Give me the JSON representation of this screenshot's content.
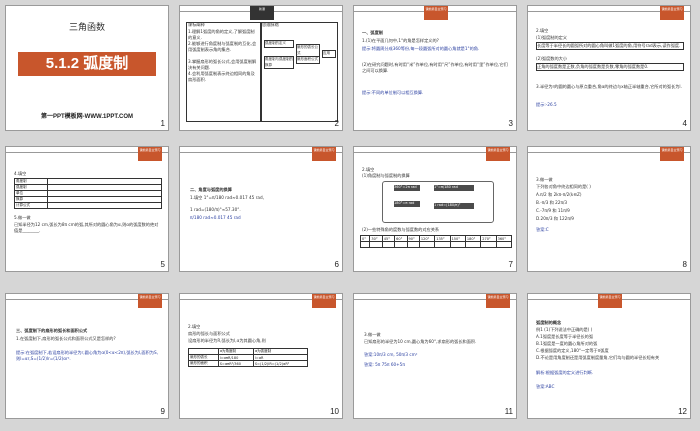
{
  "slides": [
    {
      "num": "1",
      "title": "三角函数",
      "band": "5.1.2   弧度制",
      "footer": "第一PPT模板网-WWW.1PPT.COM"
    },
    {
      "num": "2",
      "tag": "新课",
      "col1_head": "课标阐释",
      "col2_head": "思维脉络",
      "lines": [
        "1.理解1弧度的角的定义,了解弧度制的意义.",
        "2.能够进行角度制与弧度制的互化,会用弧度制表示角的集合.",
        "3.掌握扇形的弧长公式,会用弧度制解决有关问题.",
        "4.会利用弧度制表示终边相同的角及扇形面积."
      ],
      "mind": [
        "弧度制的定义",
        "角度制与弧度制的换算",
        "扇形的弧长公式",
        "扇形面积公式",
        "应用"
      ]
    },
    {
      "num": "3",
      "tag": "课前篇自主预习",
      "lines": [
        "一、弧度制",
        "1.(1)在平面几何中,1°的角是怎样定义的?",
        "提示:将圆周分成360等份,每一段圆弧所对的圆心角就是1°的角.",
        "(2)在研究问题时,有时用“米”作单位,有时用“尺”作单位,有时用“里”作单位,它们之间可以换算.",
        "提示:不同的单位制可以相互换算."
      ]
    },
    {
      "num": "4",
      "tag": "课前篇自主预习",
      "lines": [
        "2.填空",
        "(1)弧度制的定义",
        "长度等于半径长的圆弧所对的圆心角叫做1弧度的角,用符号rad表示,读作弧度.",
        "(2)弧度数的大小",
        "正角的弧度数是正数,负角的弧度数是负数,零角的弧度数是0.",
        "3.半径为r的圆的圆心与原点重合,角α的终边与x轴正半轴重合,它所对的弧长为l.",
        "提示:-26.5"
      ]
    },
    {
      "num": "5",
      "tag": "课前篇自主预习",
      "table_head": "4.填空",
      "rows": [
        [
          "角度制",
          ""
        ],
        [
          "弧度制",
          ""
        ],
        [
          "单位",
          ""
        ],
        [
          "换算",
          ""
        ],
        [
          "计算公式",
          ""
        ]
      ],
      "lines": [
        "5.做一做",
        "已知半径为12 cm,弧长为8π cm的弧,其所对的圆心角为α,则α的弧度数的绝对值是________."
      ]
    },
    {
      "num": "6",
      "tag": "课前篇自主预习",
      "lines": [
        "二、角度与弧度的换算",
        "1.填空 1°=π/180 rad≈0.017 45 rad,",
        "1 rad=(180/π)°≈57.30°.",
        "π/180 rad≈0.017 45 rad"
      ]
    },
    {
      "num": "7",
      "tag": "课前篇自主预习",
      "lines": [
        "2.填空",
        "(1)角度制与弧度制的换算",
        "(2)一些特殊角的度数与弧度数的对应关系"
      ],
      "diagram": [
        "360°=2π rad",
        "180°=π rad",
        "1°=π/180 rad",
        "1 rad=(180/π)°"
      ],
      "special": [
        "0°",
        "30°",
        "45°",
        "60°",
        "90°",
        "120°",
        "135°",
        "150°",
        "180°",
        "270°",
        "360°"
      ]
    },
    {
      "num": "8",
      "tag": "课前篇自主预习",
      "lines": [
        "3.做一做",
        "下列各对角中终边相同的是(    )",
        "A.π/2 和 2kπ-π/2(k∈Z)",
        "B.-π/3 和 22π/3",
        "C.-7π/9 和 11π/9",
        "D.20π/3 和 122π/9",
        "答案:C"
      ]
    },
    {
      "num": "9",
      "tag": "课前篇自主预习",
      "lines": [
        "三、弧度制下的扇形的弧长和面积公式",
        "1.在弧度制下,扇形的弧长公式和面积公式又是怎样的?",
        "提示:在弧度制下,若设扇形的半径为r,圆心角为α(0<α<2π),弧长为l,面积为S,则l=αr,S=(1/2)lr=(1/2)αr²."
      ]
    },
    {
      "num": "10",
      "tag": "课前篇自主预习",
      "lines": [
        "2.填空",
        "扇形的弧长与面积公式",
        "设扇形的半径为R,弧长为l,α为其圆心角,则"
      ],
      "cols": [
        "",
        "α为角度制",
        "α为弧度制"
      ],
      "rows": [
        [
          "扇形的弧长",
          "l=απR/180",
          "l=αR"
        ],
        [
          "扇形的面积",
          "S=απR²/360",
          "S=(1/2)lR=(1/2)αR²"
        ]
      ]
    },
    {
      "num": "11",
      "tag": "课前篇自主预习",
      "lines": [
        "3.做一做",
        "已知扇形的半径为10 cm,圆心角为60°,求扇形的弧长和面积.",
        "答案:10π/3 cm, 50π/3 cm²",
        "答案: 5π   75π   60+5π"
      ]
    },
    {
      "num": "12",
      "tag": "课前篇自主预习",
      "lines": [
        "弧度制的概念",
        "例1 (1)下列说法中正确的是(    )",
        "A.1弧度是长度等于半径长的弧",
        "B.1弧度是一度的圆心角所对的弧",
        "C.根据弧度的定义,180°一定等于π弧度",
        "D.不论是用角度制还是用弧度制度量角,它们均与圆的半径长短有关",
        "解析:根据弧度的定义进行判断.",
        "答案:ABC"
      ]
    }
  ],
  "colors": {
    "accent": "#c8562c",
    "frame": "#9a9a9a",
    "background": "#d6d6d6"
  }
}
